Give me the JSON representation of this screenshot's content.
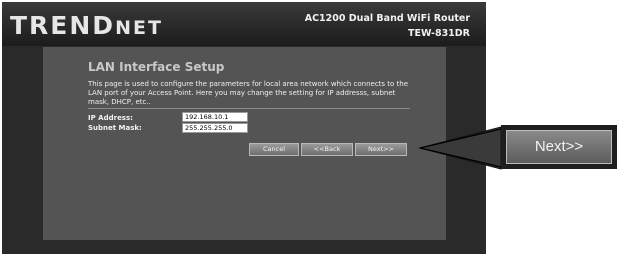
{
  "header": {
    "logo_main": "TREND",
    "logo_tail": "NET",
    "product_name": "AC1200 Dual Band WiFi Router",
    "model": "TEW-831DR"
  },
  "page": {
    "title": "LAN Interface Setup",
    "description": "This page is used to configure the parameters for local area network which connects to the LAN port of your Access Point. Here you may change the setting for IP addresss, subnet mask, DHCP, etc.."
  },
  "form": {
    "ip_label": "IP Address:",
    "ip_value": "192.168.10.1",
    "mask_label": "Subnet Mask:",
    "mask_value": "255.255.255.0"
  },
  "buttons": {
    "cancel": "Cancel",
    "back": "<<Back",
    "next": "Next>>"
  },
  "callout": {
    "label": "Next>>"
  },
  "colors": {
    "panel": "#545454",
    "frame": "#2a2a2a",
    "title": "#c8c8c8"
  }
}
